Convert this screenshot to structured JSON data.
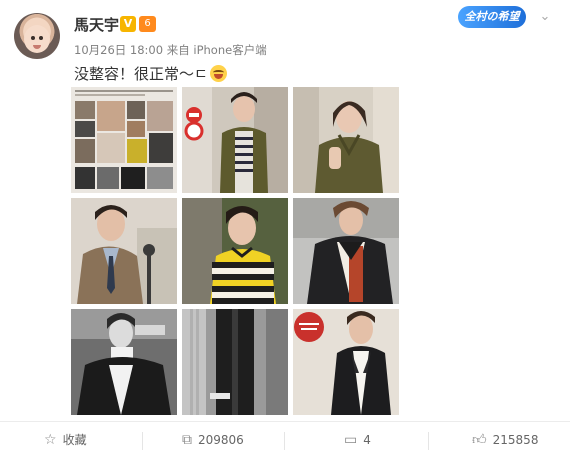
{
  "user": {
    "name": "馬天宇",
    "verified_mark": "V",
    "level_mark": "6"
  },
  "meta": {
    "date": "10月26日 18:00",
    "source_prefix": "来自",
    "source": "iPhone客户端"
  },
  "follow_badge": "全村の希望",
  "post": {
    "text": "没整容！很正常～ㄷ",
    "emoji": "laughing-face"
  },
  "images": [
    {
      "name": "magazine-collage",
      "bg": "#e8e4df"
    },
    {
      "name": "olive-jacket-street",
      "bg": "#c9c3b8"
    },
    {
      "name": "olive-jacket-closeup",
      "bg": "#d4cdc2"
    },
    {
      "name": "beige-coat-portrait",
      "bg": "#d9d1c7"
    },
    {
      "name": "striped-sweater",
      "bg": "#4e5a3e"
    },
    {
      "name": "leather-jacket",
      "bg": "#b9b9b9"
    },
    {
      "name": "white-turtleneck",
      "bg": "#5a5a5a"
    },
    {
      "name": "black-white-coat",
      "bg": "#8a8a8a"
    },
    {
      "name": "black-blazer",
      "bg": "#e3ddd5"
    }
  ],
  "actions": {
    "favorite": "收藏",
    "repost": "209806",
    "comment": "4",
    "like": "215858"
  },
  "icons": {
    "favorite": "star-icon",
    "repost": "repost-icon",
    "comment": "comment-icon",
    "like": "thumbs-up-icon",
    "menu": "chevron-down-icon"
  }
}
